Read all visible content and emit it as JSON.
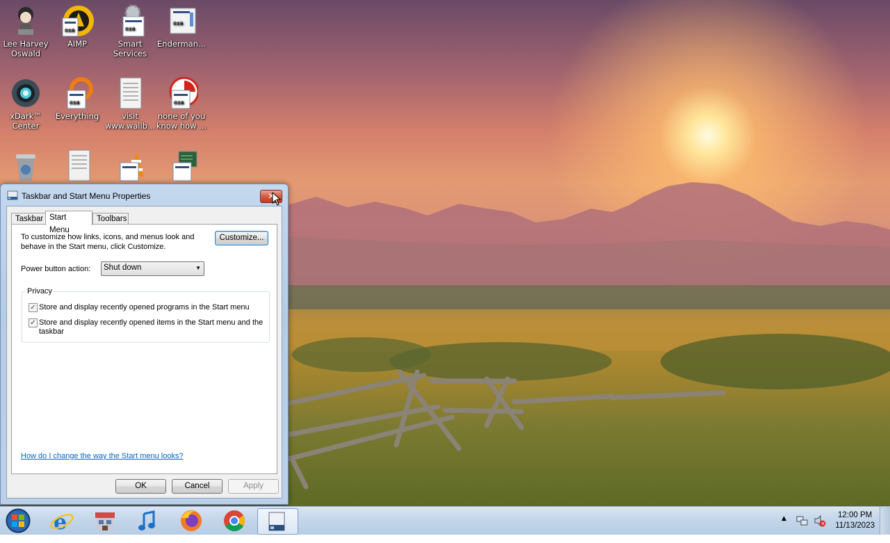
{
  "desktop": {
    "icons": [
      {
        "label": "Lee Harvey Oswald",
        "icon": "cartoon-person-icon"
      },
      {
        "label": "AIMP",
        "icon": "aimp-icon"
      },
      {
        "label": "Smart Services",
        "icon": "gear-icon"
      },
      {
        "label": "Enderman...",
        "icon": "shortcut-icon"
      },
      {
        "label": "xDark™ Center",
        "icon": "xdark-icon"
      },
      {
        "label": "Everything",
        "icon": "search-orange-icon"
      },
      {
        "label": "visit www.wallb...",
        "icon": "text-document-icon"
      },
      {
        "label": "none of you know how ...",
        "icon": "red-circle-icon"
      },
      {
        "label": "",
        "icon": "recycle-bin-icon"
      },
      {
        "label": "",
        "icon": "document-icon"
      },
      {
        "label": "",
        "icon": "vlc-icon"
      },
      {
        "label": "",
        "icon": "monitor-icon"
      }
    ]
  },
  "dialog": {
    "title": "Taskbar and Start Menu Properties",
    "close_label": "✕",
    "tabs": [
      {
        "label": "Taskbar",
        "active": false
      },
      {
        "label": "Start Menu",
        "active": true
      },
      {
        "label": "Toolbars",
        "active": false
      }
    ],
    "intro_line1": "To customize how links, icons, and menus look and",
    "intro_line2": "behave in the Start menu, click Customize.",
    "customize_label": "Customize...",
    "power_label": "Power button action:",
    "power_value": "Shut down",
    "privacy_legend": "Privacy",
    "privacy_items": [
      {
        "line1": "Store and display recently opened programs in the Start menu",
        "line2": "",
        "checked": true
      },
      {
        "line1": "Store and display recently opened items in the Start menu and the",
        "line2": "taskbar",
        "checked": true
      }
    ],
    "help_link": "How do I change the way the Start menu looks?",
    "ok_label": "OK",
    "cancel_label": "Cancel",
    "apply_label": "Apply"
  },
  "taskbar": {
    "start_icon": "windows-start-orb-icon",
    "pinned": [
      {
        "icon": "internet-explorer-icon"
      },
      {
        "icon": "store-building-icon"
      },
      {
        "icon": "music-note-icon"
      },
      {
        "icon": "firefox-icon"
      },
      {
        "icon": "chrome-icon"
      },
      {
        "icon": "taskbar-properties-icon"
      }
    ],
    "tray": {
      "overflow_label": "▲",
      "time": "12:00 PM",
      "date": "11/13/2023"
    }
  }
}
